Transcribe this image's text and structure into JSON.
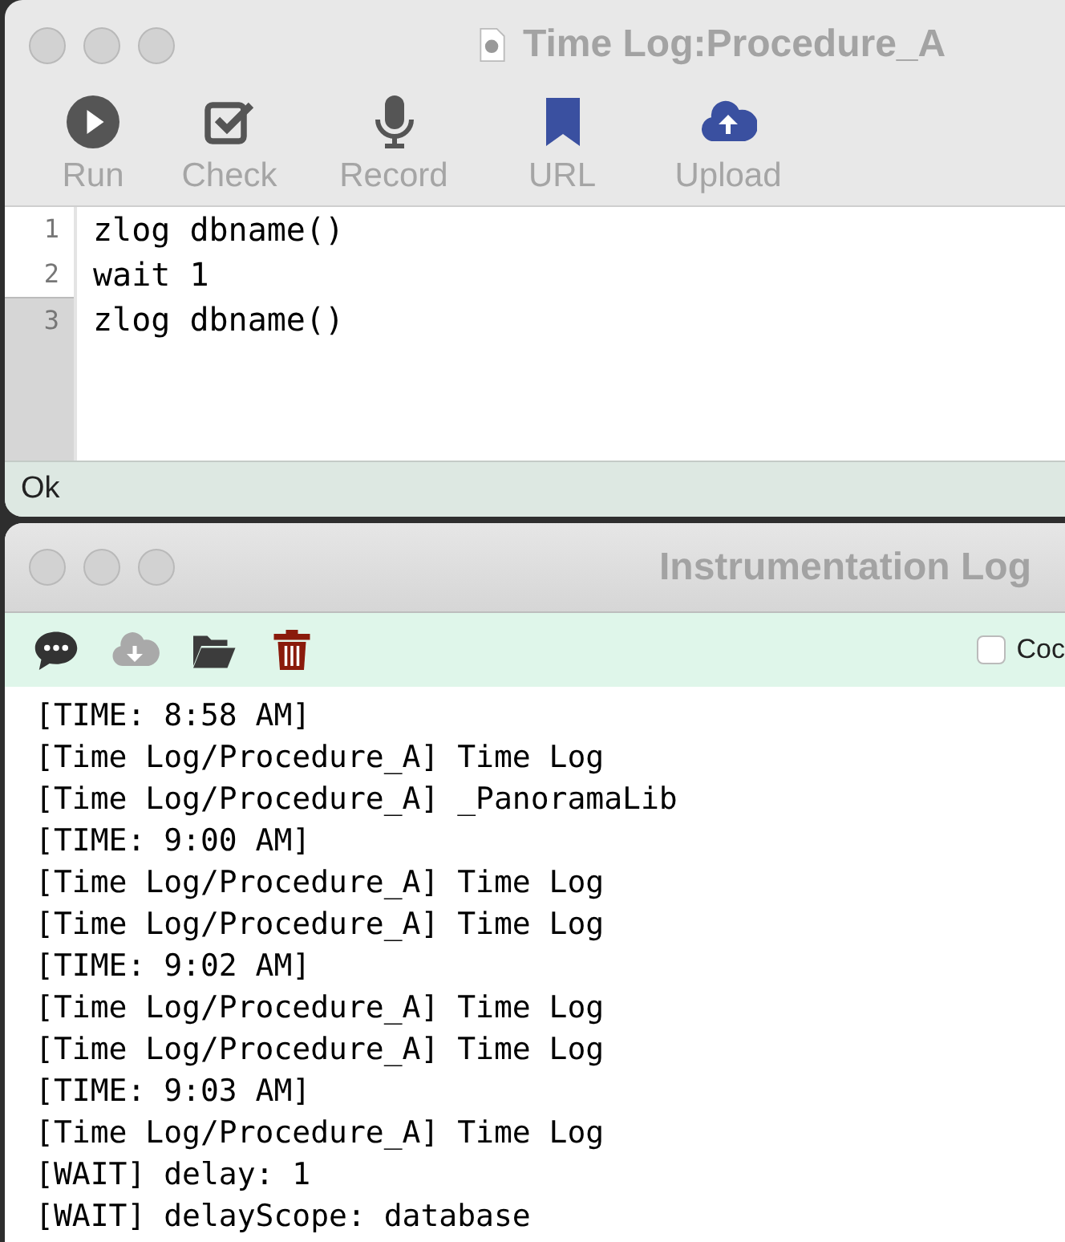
{
  "editor_window": {
    "title": "Time Log:Procedure_A",
    "toolbar": [
      {
        "label": "Run",
        "kind": "run",
        "color": "#555555"
      },
      {
        "label": "Check",
        "kind": "check",
        "color": "#555555"
      },
      {
        "label": "Record",
        "kind": "record",
        "color": "#555555"
      },
      {
        "label": "URL",
        "kind": "bookmark",
        "color": "#3a50a0"
      },
      {
        "label": "Upload",
        "kind": "upload",
        "color": "#3a50a0"
      }
    ],
    "lines": [
      {
        "number": "1",
        "code": "zlog dbname()",
        "selected": false
      },
      {
        "number": "2",
        "code": "wait 1",
        "selected": false
      },
      {
        "number": "3",
        "code": "zlog dbname()",
        "selected": true
      }
    ],
    "status_bar": "Ok"
  },
  "log_window": {
    "title": "Instrumentation Log",
    "toolbar": [
      {
        "kind": "comment",
        "color": "#333333"
      },
      {
        "kind": "download",
        "color": "#a9a9a9"
      },
      {
        "kind": "folder",
        "color": "#3c3c3c"
      },
      {
        "kind": "trash",
        "color": "#8a1b0c"
      }
    ],
    "checkbox": {
      "label": "Coc",
      "checked": false
    },
    "log_lines": [
      "[TIME: 8:58 AM]",
      "[Time Log/Procedure_A] Time Log",
      "[Time Log/Procedure_A] _PanoramaLib",
      "[TIME: 9:00 AM]",
      "[Time Log/Procedure_A] Time Log",
      "[Time Log/Procedure_A] Time Log",
      "[TIME: 9:02 AM]",
      "[Time Log/Procedure_A] Time Log",
      "[Time Log/Procedure_A] Time Log",
      "[TIME: 9:03 AM]",
      "[Time Log/Procedure_A] Time Log",
      "[WAIT] delay: 1",
      "[WAIT] delayScope: database"
    ]
  }
}
